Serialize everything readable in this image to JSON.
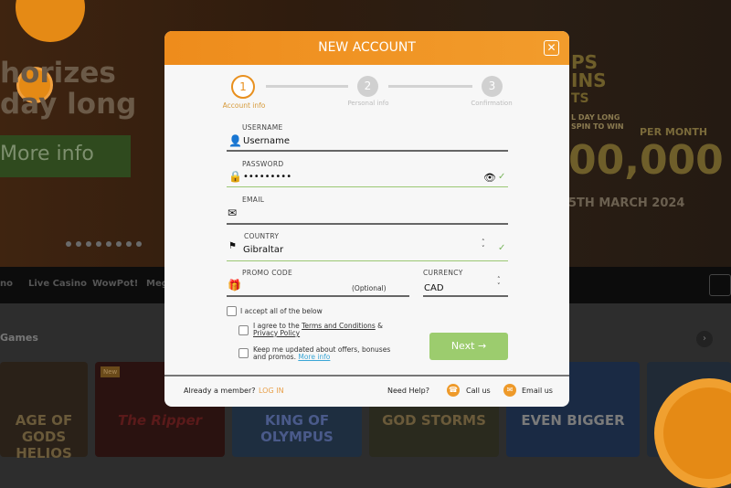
{
  "background": {
    "hero_text_lines": [
      "horizes",
      "day long"
    ],
    "hero_button": "More info",
    "promo_banner": {
      "line1": "PS",
      "line2": "INS",
      "line3": "TS",
      "sub1": "L DAY LONG",
      "sub2": "SPIN TO WIN",
      "per_month": "PER MONTH",
      "amount": "00,000",
      "date": "5TH MARCH 2024"
    },
    "nav_items": [
      "no",
      "Live Casino",
      "WowPot!",
      "Meg"
    ],
    "section_title": "Games",
    "tiles": [
      {
        "title": "AGE OF GODS HELIOS"
      },
      {
        "title": "The Ripper",
        "badge": "New"
      },
      {
        "title": "KING OF OLYMPUS"
      },
      {
        "title": "GOD STORMS"
      },
      {
        "title": "EVEN BIGGER"
      },
      {
        "title": ""
      }
    ]
  },
  "modal": {
    "title": "NEW ACCOUNT",
    "close_icon": "close-icon",
    "steps": [
      {
        "number": "1",
        "label": "Account info",
        "active": true
      },
      {
        "number": "2",
        "label": "Personal info",
        "active": false
      },
      {
        "number": "3",
        "label": "Confirmation",
        "active": false
      }
    ],
    "fields": {
      "username": {
        "label": "USERNAME",
        "value": "Username",
        "icon": "user-icon"
      },
      "password": {
        "label": "PASSWORD",
        "value": "•••••••••",
        "icon": "lock-icon",
        "valid": true
      },
      "email": {
        "label": "EMAIL",
        "value": "",
        "icon": "envelope-icon"
      },
      "country": {
        "label": "COUNTRY",
        "value": "Gibraltar",
        "icon": "flag-icon",
        "valid": true
      },
      "promo": {
        "label": "PROMO CODE",
        "placeholder": "(Optional)",
        "icon": "gift-icon"
      },
      "currency": {
        "label": "CURRENCY",
        "value": "CAD"
      }
    },
    "checkboxes": {
      "accept_all": "I accept all of the below",
      "terms_prefix": "I agree to the ",
      "terms_link": "Terms and Conditions",
      "terms_amp": " &",
      "privacy_link": "Privacy Policy",
      "updates_text_1": "Keep me updated about offers, bonuses",
      "updates_text_2": "and promos. ",
      "more_info_link": "More info"
    },
    "next_button": "Next →",
    "footer": {
      "already_member": "Already a member?",
      "login": "LOG IN",
      "need_help": "Need Help?",
      "call_us": "Call us",
      "email_us": "Email us"
    }
  },
  "colors": {
    "accent": "#ee8c1c",
    "success": "#9ccc6e",
    "link": "#3aa6d6"
  }
}
